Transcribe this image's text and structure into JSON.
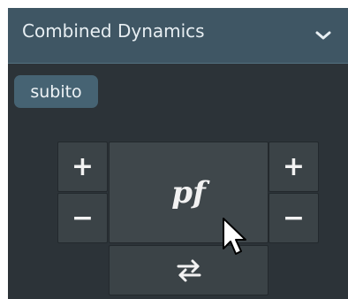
{
  "panel": {
    "title": "Combined Dynamics",
    "collapse_icon": "chevron-down-icon"
  },
  "subito_label": "subito",
  "dynamic_value": "pf",
  "left_stepper": {
    "increase": "+",
    "decrease": "−"
  },
  "right_stepper": {
    "increase": "+",
    "decrease": "−"
  },
  "swap_icon": "swap-arrows-icon",
  "colors": {
    "header_bg": "#3f5664",
    "panel_bg": "#2c3338",
    "button_bg": "#3b4347",
    "badge_bg": "#466373",
    "text": "#eef3f6"
  }
}
